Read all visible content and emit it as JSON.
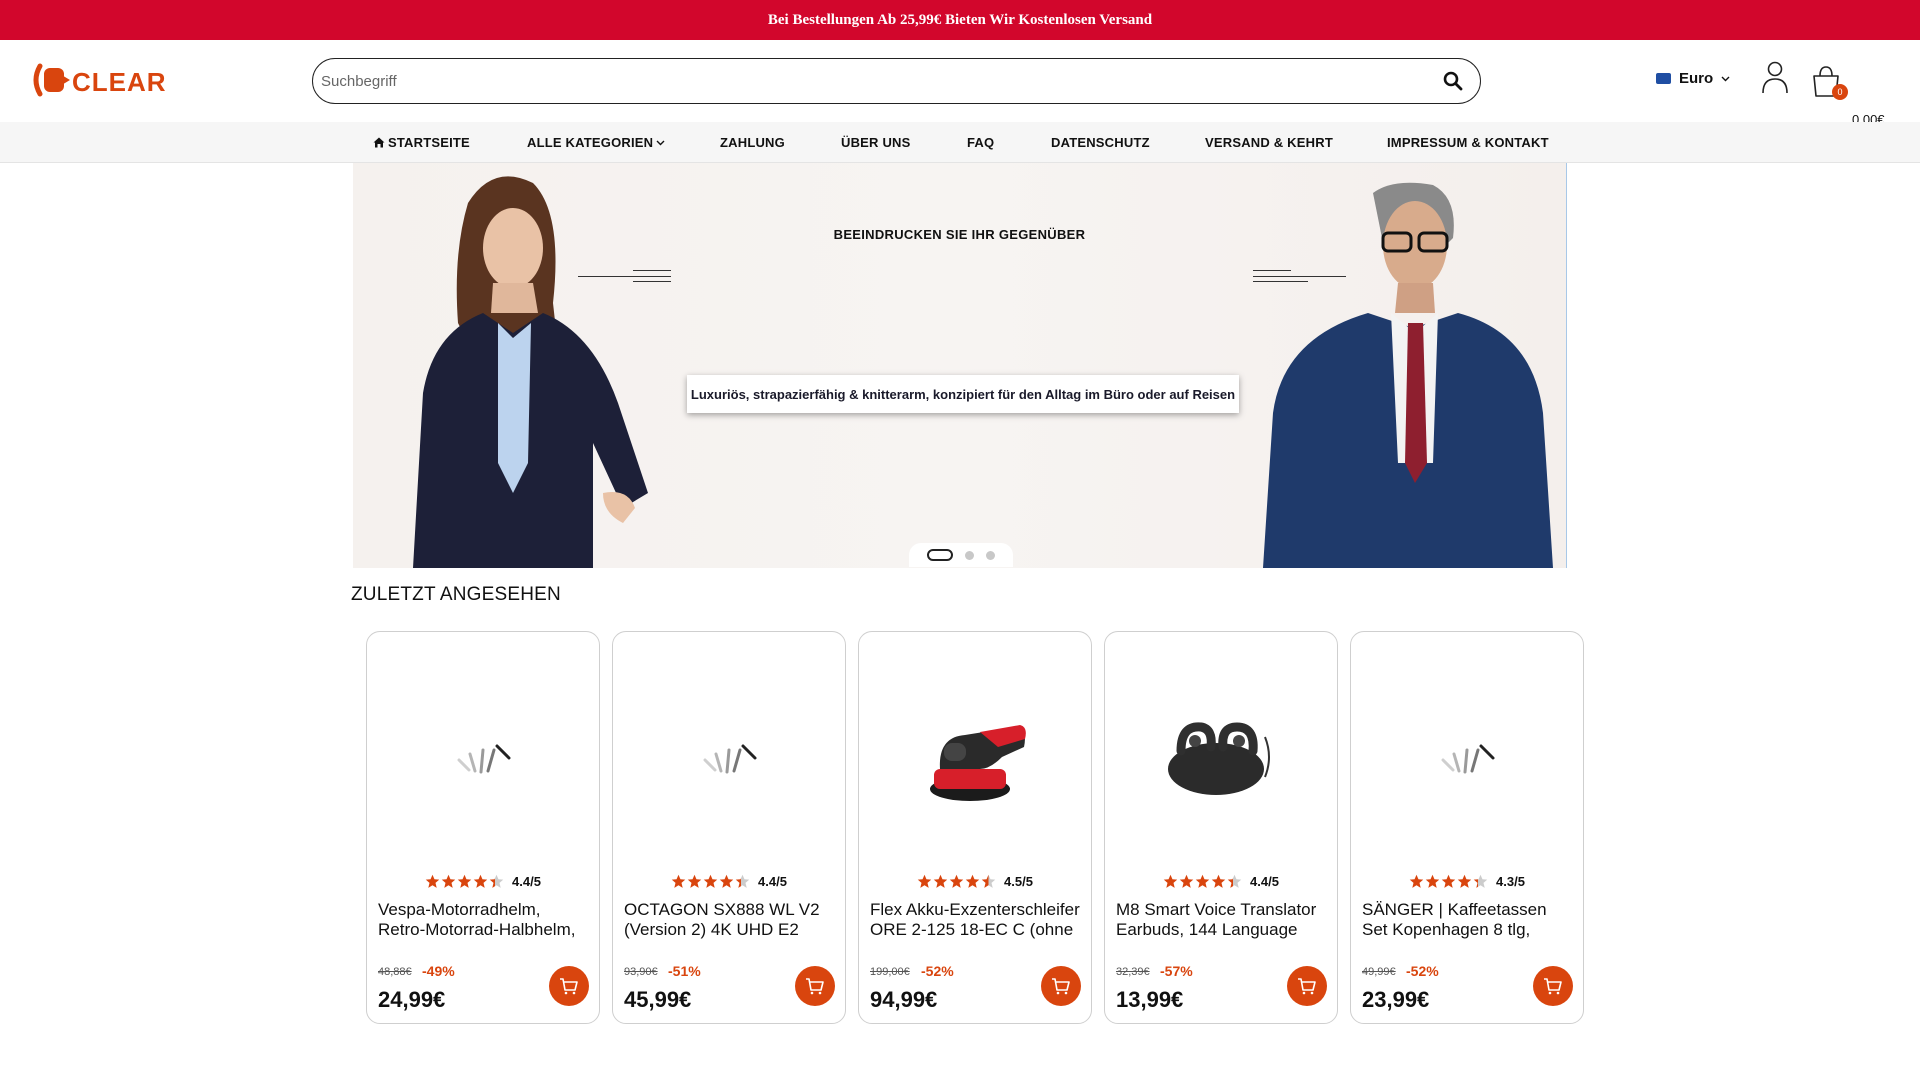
{
  "announcement": "Bei Bestellungen Ab 25,99€ Bieten Wir Kostenlosen Versand",
  "brand": {
    "name": "CLEAR",
    "color": "#d9450e"
  },
  "search": {
    "placeholder": "Suchbegriff"
  },
  "currency": {
    "label": "Euro"
  },
  "cart": {
    "count": "0",
    "total": "0,00€"
  },
  "nav": {
    "items": [
      {
        "label": "STARTSEITE",
        "icon": "home-icon"
      },
      {
        "label": "ALLE KATEGORIEN",
        "icon": "chevron-down-icon"
      },
      {
        "label": "ZAHLUNG"
      },
      {
        "label": "ÜBER UNS"
      },
      {
        "label": "FAQ"
      },
      {
        "label": "DATENSCHUTZ"
      },
      {
        "label": "VERSAND & KEHRT"
      },
      {
        "label": "IMPRESSUM & KONTAKT"
      }
    ]
  },
  "hero": {
    "heading": "BEEINDRUCKEN SIE IHR GEGENÜBER",
    "tagline": "Luxuriös, strapazierfähig & knitterarm, konzipiert für den Alltag im Büro oder auf Reisen",
    "slides_count": 3,
    "active_slide": 1
  },
  "recently_viewed": {
    "title": "ZULETZT ANGESEHEN",
    "products": [
      {
        "title": "Vespa-Motorradhelm, Retro-Motorrad-Halbhelm,",
        "rating": "4.4/5",
        "rating_value": 4.4,
        "old_price": "48,88€",
        "discount": "-49%",
        "price": "24,99€",
        "image": "loading-icon"
      },
      {
        "title": "OCTAGON SX888 WL V2 (Version 2) 4K UHD E2",
        "rating": "4.4/5",
        "rating_value": 4.4,
        "old_price": "93,90€",
        "discount": "-51%",
        "price": "45,99€",
        "image": "loading-icon"
      },
      {
        "title": "Flex Akku-Exzenterschleifer ORE 2-125 18-EC C (ohne",
        "rating": "4.5/5",
        "rating_value": 4.5,
        "old_price": "199,00€",
        "discount": "-52%",
        "price": "94,99€",
        "image": "sander-image"
      },
      {
        "title": "M8 Smart Voice Translator Earbuds, 144 Language",
        "rating": "4.4/5",
        "rating_value": 4.4,
        "old_price": "32,39€",
        "discount": "-57%",
        "price": "13,99€",
        "image": "earbuds-image"
      },
      {
        "title": "SÄNGER | Kaffeetassen Set Kopenhagen 8 tlg,",
        "rating": "4.3/5",
        "rating_value": 4.3,
        "old_price": "49,99€",
        "discount": "-52%",
        "price": "23,99€",
        "image": "loading-icon"
      }
    ]
  },
  "colors": {
    "announcement_bg": "#d2062c",
    "accent": "#d9450e",
    "nav_bg": "#f6f6f6"
  }
}
